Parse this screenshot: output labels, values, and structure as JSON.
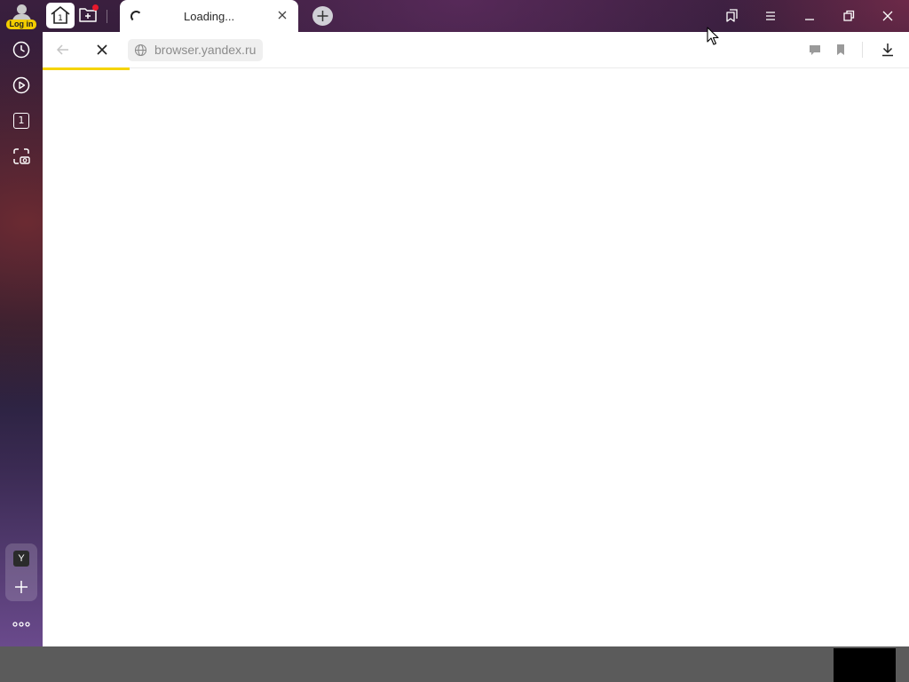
{
  "profile": {
    "login_label": "Log in",
    "icon": "user-avatar-icon"
  },
  "tabs": [
    {
      "title": "Loading...",
      "active": true,
      "status": "loading"
    }
  ],
  "home_tab_count": "1",
  "sidebar": {
    "items": [
      {
        "name": "history",
        "icon": "clock-icon"
      },
      {
        "name": "video",
        "icon": "play-circle-icon"
      },
      {
        "name": "tabs",
        "icon": "tab-count-icon",
        "count": "1"
      },
      {
        "name": "screenshot",
        "icon": "screenshot-camera-icon"
      }
    ],
    "app_letter": "Y",
    "more_icon": "more-dots-icon"
  },
  "addressbar": {
    "url": "browser.yandex.ru",
    "icons": [
      "back-arrow-icon",
      "stop-loading-icon",
      "globe-icon",
      "chat-icon",
      "bookmark-icon",
      "download-icon"
    ]
  },
  "window_controls": [
    "collections-icon",
    "menu-icon",
    "minimize-icon",
    "restore-icon",
    "close-icon"
  ],
  "page": {
    "load_progress": 0.1
  },
  "colors": {
    "accent_yellow": "#f5d400",
    "badge_yellow": "#f2cc00",
    "notify_red": "#e8192c",
    "address_bg": "#efefef",
    "url_text": "#8c8c8c"
  }
}
